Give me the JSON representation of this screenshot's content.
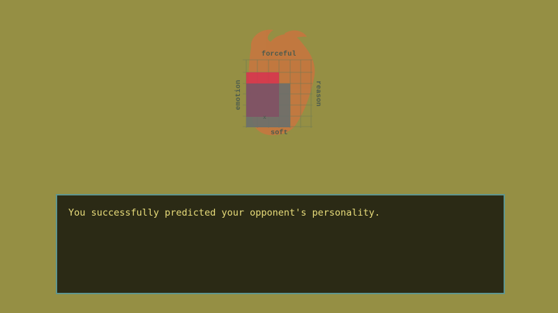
{
  "personality_chart": {
    "top_label": "forceful",
    "bottom_label": "soft",
    "left_label": "emotion",
    "right_label": "reason",
    "colors": {
      "emblem": "#c9753f",
      "grid": "#7a7b3e",
      "predicted_box": "#d6344f",
      "actual_box": "#6a6f6d",
      "overlap": "#7b5565"
    }
  },
  "dialog": {
    "message": "You successfully predicted your opponent's personality."
  },
  "colors": {
    "background": "#958f44",
    "dialog_bg": "#2b2a15",
    "dialog_border": "#5f9690",
    "dialog_text": "#e9dd7b"
  }
}
